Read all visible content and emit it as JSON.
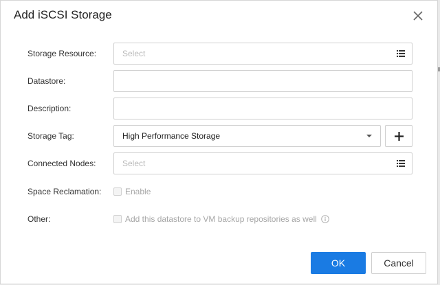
{
  "dialog": {
    "title": "Add iSCSI Storage",
    "close_icon": "close-icon"
  },
  "form": {
    "storage_resource": {
      "label": "Storage Resource:",
      "placeholder": "Select",
      "icon": "list-icon"
    },
    "datastore": {
      "label": "Datastore:",
      "value": ""
    },
    "description": {
      "label": "Description:",
      "value": ""
    },
    "storage_tag": {
      "label": "Storage Tag:",
      "value": "High Performance Storage",
      "icon": "chevron-down-icon",
      "add_icon": "plus-icon"
    },
    "connected_nodes": {
      "label": "Connected Nodes:",
      "placeholder": "Select",
      "icon": "list-icon"
    },
    "space_reclamation": {
      "label": "Space Reclamation:",
      "checkbox_label": "Enable",
      "checked": false,
      "disabled": true
    },
    "other": {
      "label": "Other:",
      "checkbox_label": "Add this datastore to VM backup repositories as well",
      "checked": false,
      "disabled": true,
      "info_icon": "info-icon"
    }
  },
  "buttons": {
    "ok": "OK",
    "cancel": "Cancel"
  },
  "colors": {
    "primary": "#1a7be3",
    "border": "#cfcfcf",
    "placeholder": "#b9b9b9",
    "disabled_text": "#a6a6a6"
  }
}
